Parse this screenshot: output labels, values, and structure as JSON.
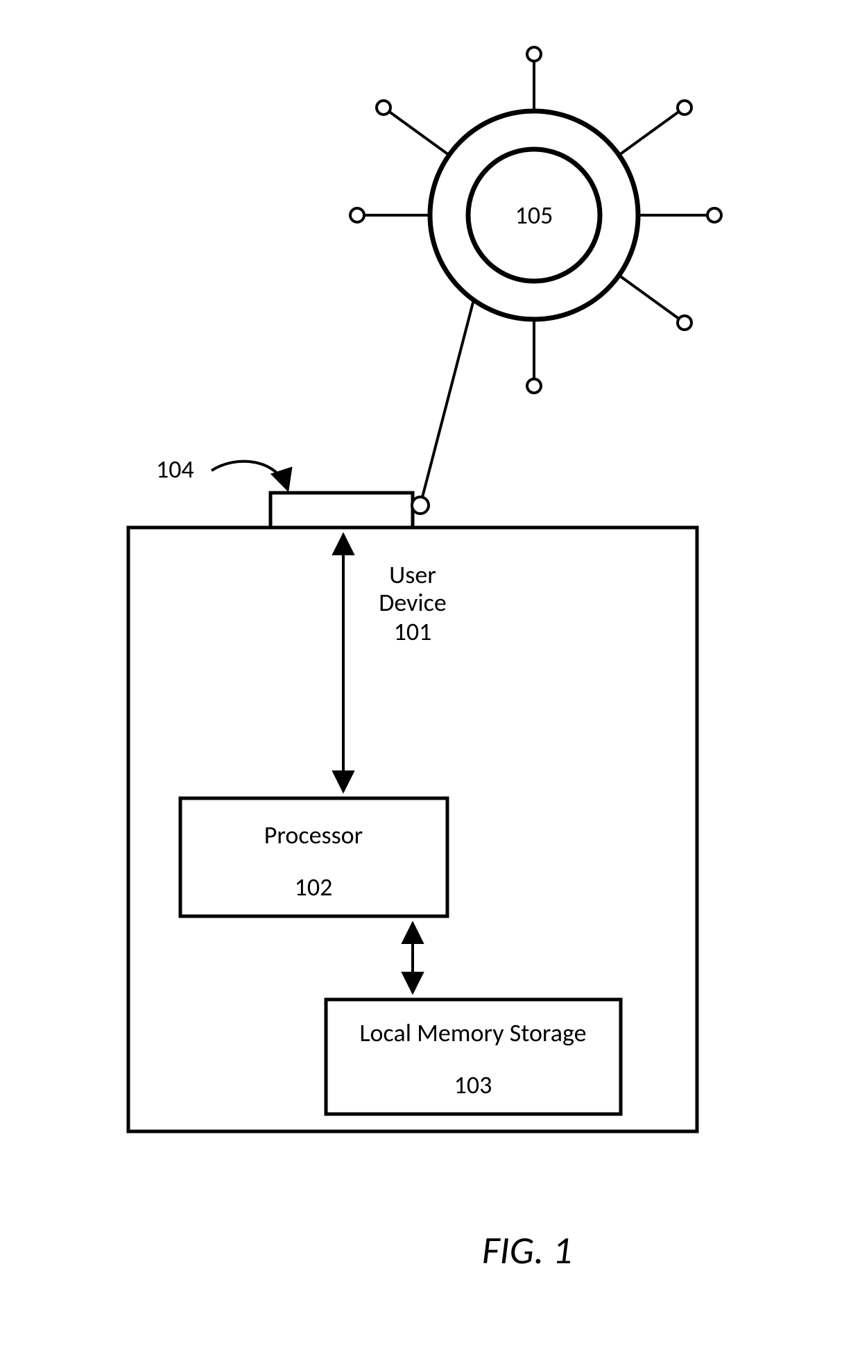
{
  "diagram": {
    "ref_104": "104",
    "network_hub_label": "105",
    "user_device": {
      "line1": "User",
      "line2": "Device",
      "num": "101"
    },
    "processor": {
      "label": "Processor",
      "num": "102"
    },
    "memory": {
      "label": "Local Memory Storage",
      "num": "103"
    },
    "figure_caption": "FIG. 1"
  }
}
